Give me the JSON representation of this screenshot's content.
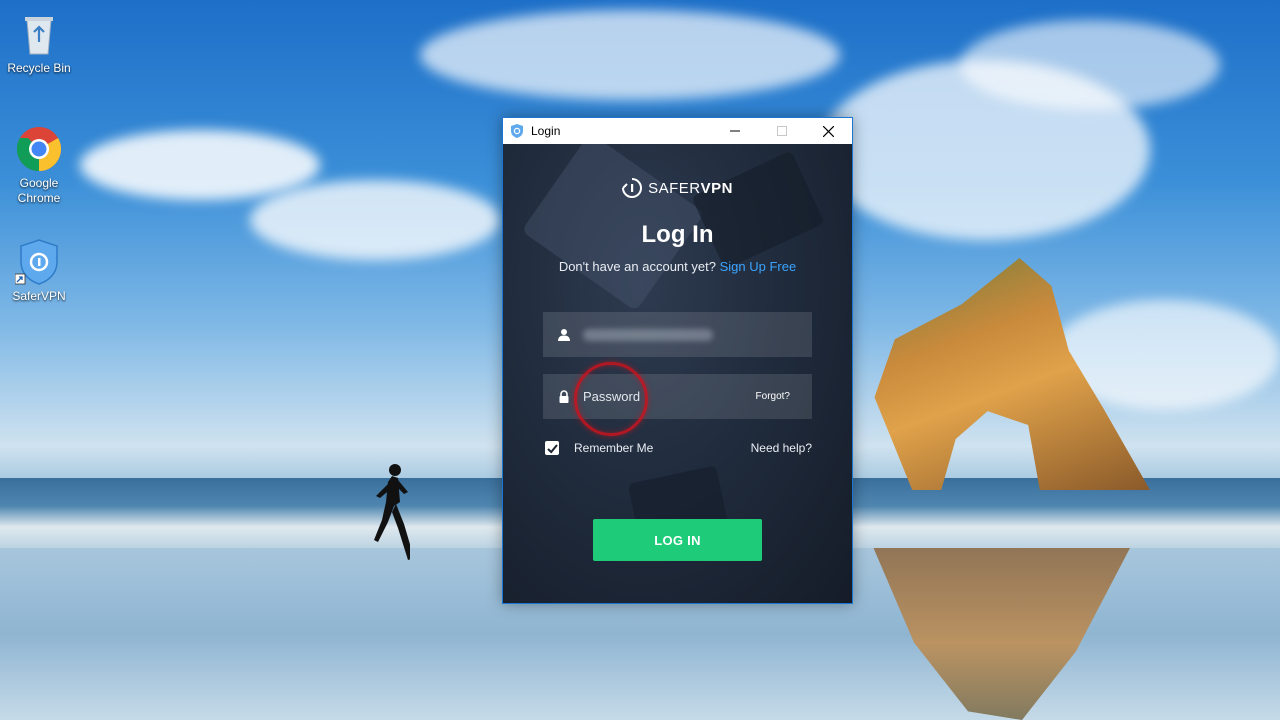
{
  "desktop": {
    "icons": [
      {
        "label": "Recycle Bin"
      },
      {
        "label": "Google\nChrome"
      },
      {
        "label": "SaferVPN"
      }
    ]
  },
  "window": {
    "title": "Login",
    "controls": {
      "minimize": "—",
      "maximize": "☐",
      "close": "✕"
    }
  },
  "login": {
    "brand_part1": "SAFER",
    "brand_part2": "VPN",
    "heading": "Log In",
    "no_account_text": "Don't have an account yet?",
    "signup_link": "Sign Up Free",
    "password_placeholder": "Password",
    "forgot_link": "Forgot?",
    "remember_label": "Remember Me",
    "remember_checked": true,
    "need_help_link": "Need help?",
    "submit_label": "LOG IN"
  },
  "colors": {
    "accent_green": "#1ecb79",
    "link_blue": "#3aa4ff",
    "window_border": "#1b76d2"
  }
}
